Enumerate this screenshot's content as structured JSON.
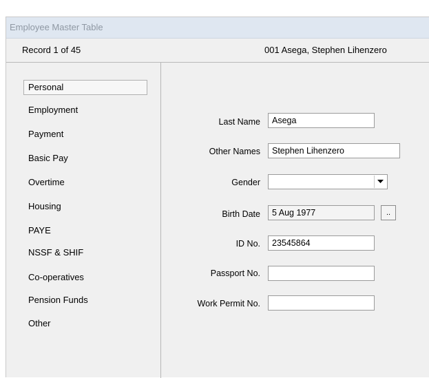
{
  "window": {
    "title": "Employee Master Table"
  },
  "record": {
    "position": "Record 1 of 45",
    "current": "001  Asega, Stephen Lihenzero"
  },
  "sidebar": {
    "items": [
      {
        "label": "Personal",
        "selected": true
      },
      {
        "label": "Employment"
      },
      {
        "label": "Payment"
      },
      {
        "label": "Basic Pay"
      },
      {
        "label": "Overtime"
      },
      {
        "label": "Housing"
      },
      {
        "label": "PAYE"
      },
      {
        "label": "NSSF & SHIF"
      },
      {
        "label": "Co-operatives"
      },
      {
        "label": "Pension Funds"
      },
      {
        "label": "Other"
      }
    ]
  },
  "form": {
    "last_name": {
      "label": "Last Name",
      "value": "Asega"
    },
    "other_names": {
      "label": "Other Names",
      "value": "Stephen Lihenzero"
    },
    "gender": {
      "label": "Gender",
      "value": ""
    },
    "birth_date": {
      "label": "Birth Date",
      "value": "5 Aug 1977",
      "button": ".."
    },
    "id_no": {
      "label": "ID No.",
      "value": "23545864"
    },
    "passport_no": {
      "label": "Passport No.",
      "value": ""
    },
    "work_permit_no": {
      "label": "Work Permit No.",
      "value": ""
    }
  },
  "icons": {
    "gender_dropdown": "chevron-down-icon"
  }
}
